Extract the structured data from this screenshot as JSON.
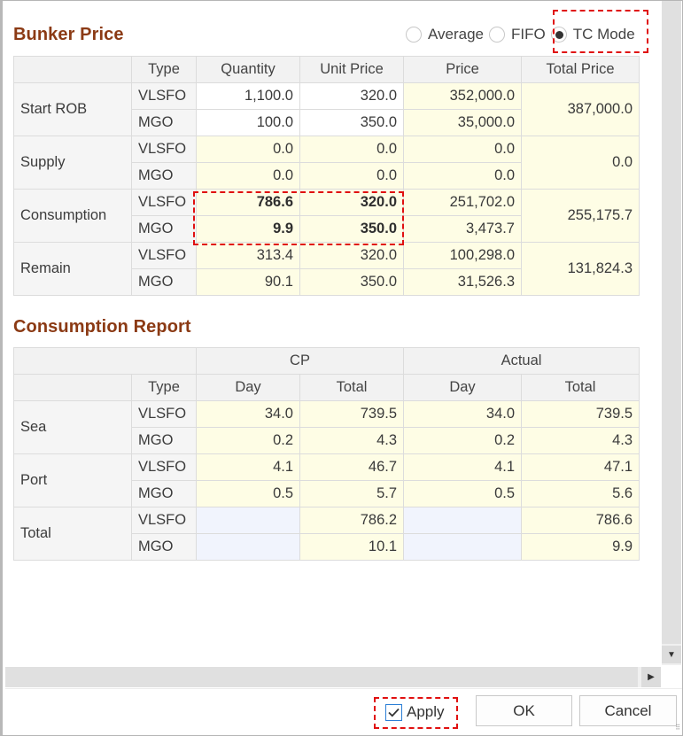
{
  "bunker_price": {
    "title": "Bunker Price",
    "mode_options": [
      {
        "label": "Average",
        "selected": false
      },
      {
        "label": "FIFO",
        "selected": false
      },
      {
        "label": "TC Mode",
        "selected": true
      }
    ],
    "headers": [
      "",
      "Type",
      "Quantity",
      "Unit Price",
      "Price",
      "Total Price"
    ],
    "groups": [
      {
        "label": "Start ROB",
        "total_price": "387,000.0",
        "rows": [
          {
            "type": "VLSFO",
            "quantity": "1,100.0",
            "unit_price": "320.0",
            "price": "352,000.0"
          },
          {
            "type": "MGO",
            "quantity": "100.0",
            "unit_price": "350.0",
            "price": "35,000.0"
          }
        ]
      },
      {
        "label": "Supply",
        "total_price": "0.0",
        "rows": [
          {
            "type": "VLSFO",
            "quantity": "0.0",
            "unit_price": "0.0",
            "price": "0.0"
          },
          {
            "type": "MGO",
            "quantity": "0.0",
            "unit_price": "0.0",
            "price": "0.0"
          }
        ]
      },
      {
        "label": "Consumption",
        "total_price": "255,175.7",
        "rows": [
          {
            "type": "VLSFO",
            "quantity": "786.6",
            "unit_price": "320.0",
            "price": "251,702.0"
          },
          {
            "type": "MGO",
            "quantity": "9.9",
            "unit_price": "350.0",
            "price": "3,473.7"
          }
        ]
      },
      {
        "label": "Remain",
        "total_price": "131,824.3",
        "rows": [
          {
            "type": "VLSFO",
            "quantity": "313.4",
            "unit_price": "320.0",
            "price": "100,298.0"
          },
          {
            "type": "MGO",
            "quantity": "90.1",
            "unit_price": "350.0",
            "price": "31,526.3"
          }
        ]
      }
    ]
  },
  "consumption_report": {
    "title": "Consumption Report",
    "group_headers": [
      "CP",
      "Actual"
    ],
    "sub_headers": [
      "",
      "Type",
      "Day",
      "Total",
      "Day",
      "Total"
    ],
    "groups": [
      {
        "label": "Sea",
        "rows": [
          {
            "type": "VLSFO",
            "cp_day": "34.0",
            "cp_total": "739.5",
            "actual_day": "34.0",
            "actual_total": "739.5"
          },
          {
            "type": "MGO",
            "cp_day": "0.2",
            "cp_total": "4.3",
            "actual_day": "0.2",
            "actual_total": "4.3"
          }
        ]
      },
      {
        "label": "Port",
        "rows": [
          {
            "type": "VLSFO",
            "cp_day": "4.1",
            "cp_total": "46.7",
            "actual_day": "4.1",
            "actual_total": "47.1"
          },
          {
            "type": "MGO",
            "cp_day": "0.5",
            "cp_total": "5.7",
            "actual_day": "0.5",
            "actual_total": "5.6"
          }
        ]
      },
      {
        "label": "Total",
        "rows": [
          {
            "type": "VLSFO",
            "cp_day": "",
            "cp_total": "786.2",
            "actual_day": "",
            "actual_total": "786.6"
          },
          {
            "type": "MGO",
            "cp_day": "",
            "cp_total": "10.1",
            "actual_day": "",
            "actual_total": "9.9"
          }
        ]
      }
    ]
  },
  "footer": {
    "apply_label": "Apply",
    "apply_checked": true,
    "ok_label": "OK",
    "cancel_label": "Cancel"
  },
  "colors": {
    "section_title": "#8b3a14",
    "highlight_box": "#e01010",
    "editable_cell": "#fefde5",
    "empty_cell": "#f1f4fd",
    "header_cell": "#f2f2f2"
  }
}
